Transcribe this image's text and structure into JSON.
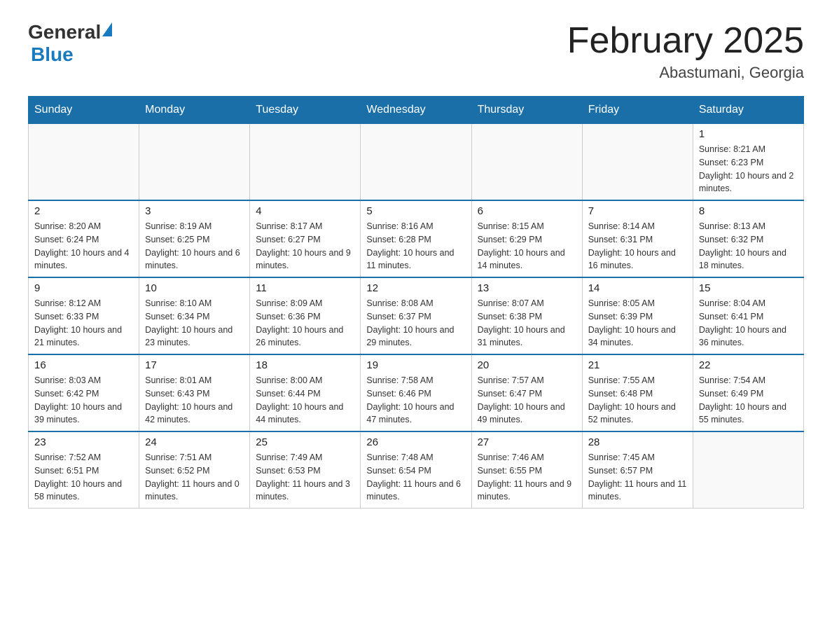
{
  "header": {
    "logo_general": "General",
    "logo_blue": "Blue",
    "month_title": "February 2025",
    "location": "Abastumani, Georgia"
  },
  "days_of_week": [
    "Sunday",
    "Monday",
    "Tuesday",
    "Wednesday",
    "Thursday",
    "Friday",
    "Saturday"
  ],
  "weeks": [
    [
      {
        "day": "",
        "info": ""
      },
      {
        "day": "",
        "info": ""
      },
      {
        "day": "",
        "info": ""
      },
      {
        "day": "",
        "info": ""
      },
      {
        "day": "",
        "info": ""
      },
      {
        "day": "",
        "info": ""
      },
      {
        "day": "1",
        "info": "Sunrise: 8:21 AM\nSunset: 6:23 PM\nDaylight: 10 hours and 2 minutes."
      }
    ],
    [
      {
        "day": "2",
        "info": "Sunrise: 8:20 AM\nSunset: 6:24 PM\nDaylight: 10 hours and 4 minutes."
      },
      {
        "day": "3",
        "info": "Sunrise: 8:19 AM\nSunset: 6:25 PM\nDaylight: 10 hours and 6 minutes."
      },
      {
        "day": "4",
        "info": "Sunrise: 8:17 AM\nSunset: 6:27 PM\nDaylight: 10 hours and 9 minutes."
      },
      {
        "day": "5",
        "info": "Sunrise: 8:16 AM\nSunset: 6:28 PM\nDaylight: 10 hours and 11 minutes."
      },
      {
        "day": "6",
        "info": "Sunrise: 8:15 AM\nSunset: 6:29 PM\nDaylight: 10 hours and 14 minutes."
      },
      {
        "day": "7",
        "info": "Sunrise: 8:14 AM\nSunset: 6:31 PM\nDaylight: 10 hours and 16 minutes."
      },
      {
        "day": "8",
        "info": "Sunrise: 8:13 AM\nSunset: 6:32 PM\nDaylight: 10 hours and 18 minutes."
      }
    ],
    [
      {
        "day": "9",
        "info": "Sunrise: 8:12 AM\nSunset: 6:33 PM\nDaylight: 10 hours and 21 minutes."
      },
      {
        "day": "10",
        "info": "Sunrise: 8:10 AM\nSunset: 6:34 PM\nDaylight: 10 hours and 23 minutes."
      },
      {
        "day": "11",
        "info": "Sunrise: 8:09 AM\nSunset: 6:36 PM\nDaylight: 10 hours and 26 minutes."
      },
      {
        "day": "12",
        "info": "Sunrise: 8:08 AM\nSunset: 6:37 PM\nDaylight: 10 hours and 29 minutes."
      },
      {
        "day": "13",
        "info": "Sunrise: 8:07 AM\nSunset: 6:38 PM\nDaylight: 10 hours and 31 minutes."
      },
      {
        "day": "14",
        "info": "Sunrise: 8:05 AM\nSunset: 6:39 PM\nDaylight: 10 hours and 34 minutes."
      },
      {
        "day": "15",
        "info": "Sunrise: 8:04 AM\nSunset: 6:41 PM\nDaylight: 10 hours and 36 minutes."
      }
    ],
    [
      {
        "day": "16",
        "info": "Sunrise: 8:03 AM\nSunset: 6:42 PM\nDaylight: 10 hours and 39 minutes."
      },
      {
        "day": "17",
        "info": "Sunrise: 8:01 AM\nSunset: 6:43 PM\nDaylight: 10 hours and 42 minutes."
      },
      {
        "day": "18",
        "info": "Sunrise: 8:00 AM\nSunset: 6:44 PM\nDaylight: 10 hours and 44 minutes."
      },
      {
        "day": "19",
        "info": "Sunrise: 7:58 AM\nSunset: 6:46 PM\nDaylight: 10 hours and 47 minutes."
      },
      {
        "day": "20",
        "info": "Sunrise: 7:57 AM\nSunset: 6:47 PM\nDaylight: 10 hours and 49 minutes."
      },
      {
        "day": "21",
        "info": "Sunrise: 7:55 AM\nSunset: 6:48 PM\nDaylight: 10 hours and 52 minutes."
      },
      {
        "day": "22",
        "info": "Sunrise: 7:54 AM\nSunset: 6:49 PM\nDaylight: 10 hours and 55 minutes."
      }
    ],
    [
      {
        "day": "23",
        "info": "Sunrise: 7:52 AM\nSunset: 6:51 PM\nDaylight: 10 hours and 58 minutes."
      },
      {
        "day": "24",
        "info": "Sunrise: 7:51 AM\nSunset: 6:52 PM\nDaylight: 11 hours and 0 minutes."
      },
      {
        "day": "25",
        "info": "Sunrise: 7:49 AM\nSunset: 6:53 PM\nDaylight: 11 hours and 3 minutes."
      },
      {
        "day": "26",
        "info": "Sunrise: 7:48 AM\nSunset: 6:54 PM\nDaylight: 11 hours and 6 minutes."
      },
      {
        "day": "27",
        "info": "Sunrise: 7:46 AM\nSunset: 6:55 PM\nDaylight: 11 hours and 9 minutes."
      },
      {
        "day": "28",
        "info": "Sunrise: 7:45 AM\nSunset: 6:57 PM\nDaylight: 11 hours and 11 minutes."
      },
      {
        "day": "",
        "info": ""
      }
    ]
  ]
}
